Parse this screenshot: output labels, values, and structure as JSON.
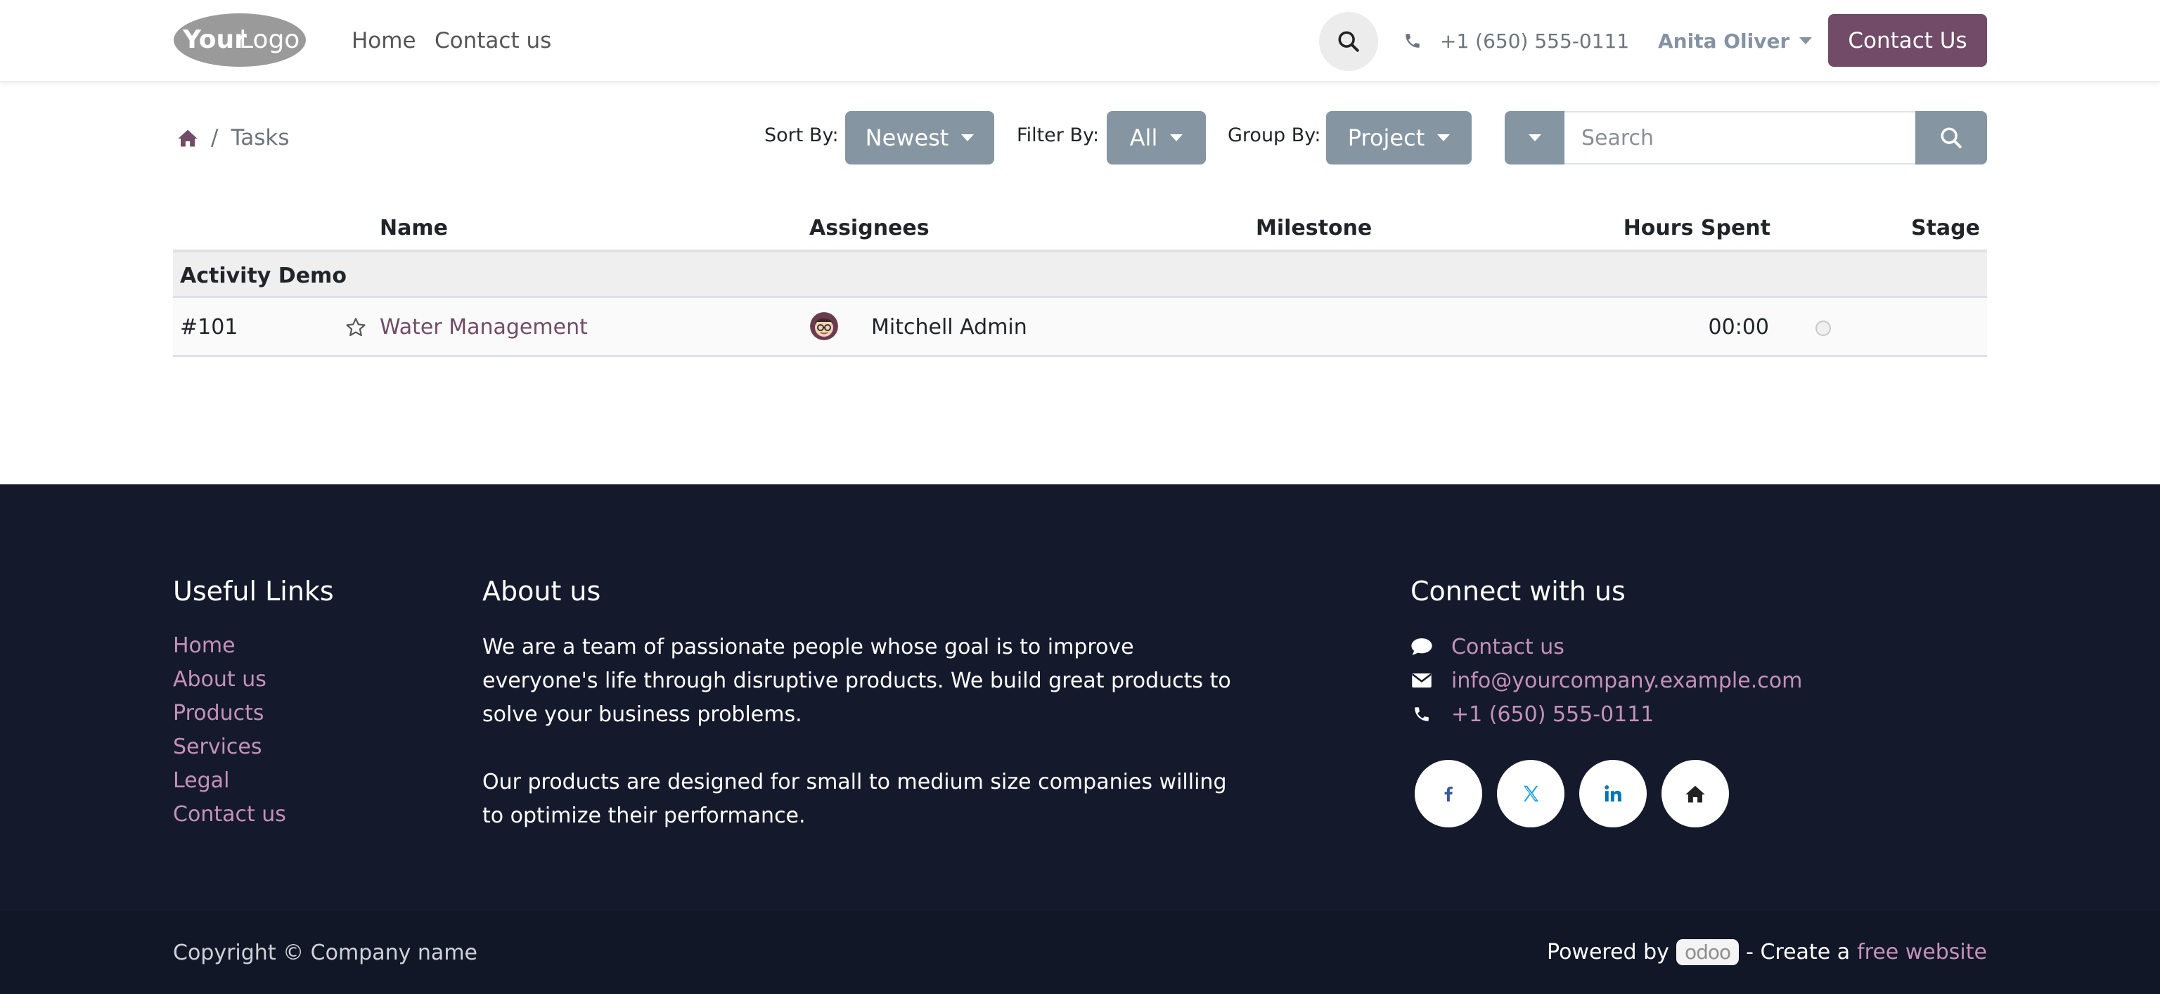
{
  "header": {
    "logo_text_bold": "Your",
    "logo_text_light": "Logo",
    "nav": [
      "Home",
      "Contact us"
    ],
    "phone": "+1 (650) 555-0111",
    "user_name": "Anita Oliver",
    "contact_button": "Contact Us"
  },
  "toolbar": {
    "breadcrumb_current": "Tasks",
    "sort_label": "Sort By:",
    "sort_value": "Newest",
    "filter_label": "Filter By:",
    "filter_value": "All",
    "group_label": "Group By:",
    "group_value": "Project",
    "search_placeholder": "Search"
  },
  "table": {
    "columns": [
      "Name",
      "Assignees",
      "Milestone",
      "Hours Spent",
      "Stage"
    ],
    "groups": [
      {
        "name": "Activity Demo",
        "rows": [
          {
            "id": "#101",
            "name": "Water Management",
            "assignee": "Mitchell Admin",
            "milestone": "",
            "hours": "00:00"
          }
        ]
      }
    ]
  },
  "footer": {
    "useful_links_title": "Useful Links",
    "useful_links": [
      "Home",
      "About us",
      "Products",
      "Services",
      "Legal",
      "Contact us"
    ],
    "about_title": "About us",
    "about_lines_1": [
      "We are a team of passionate people whose goal is to improve",
      "everyone's life through disruptive products. We build great products to",
      "solve your business problems."
    ],
    "about_lines_2": [
      "Our products are designed for small to medium size companies willing",
      "to optimize their performance."
    ],
    "connect_title": "Connect with us",
    "connect_contact": "Contact us",
    "connect_email": "info@yourcompany.example.com",
    "connect_phone": "+1 (650) 555-0111",
    "social": [
      "facebook-icon",
      "x-twitter-icon",
      "linkedin-icon",
      "home-icon"
    ],
    "copyright": "Copyright © Company name",
    "powered_by": "Powered by",
    "odoo_badge": "odoo",
    "create_a": "- Create a",
    "free_website": "free website"
  },
  "colors": {
    "brand": "#714b67",
    "button_gray": "#8595a2",
    "footer_bg": "#141a2c",
    "footer_link": "#c591b8"
  }
}
